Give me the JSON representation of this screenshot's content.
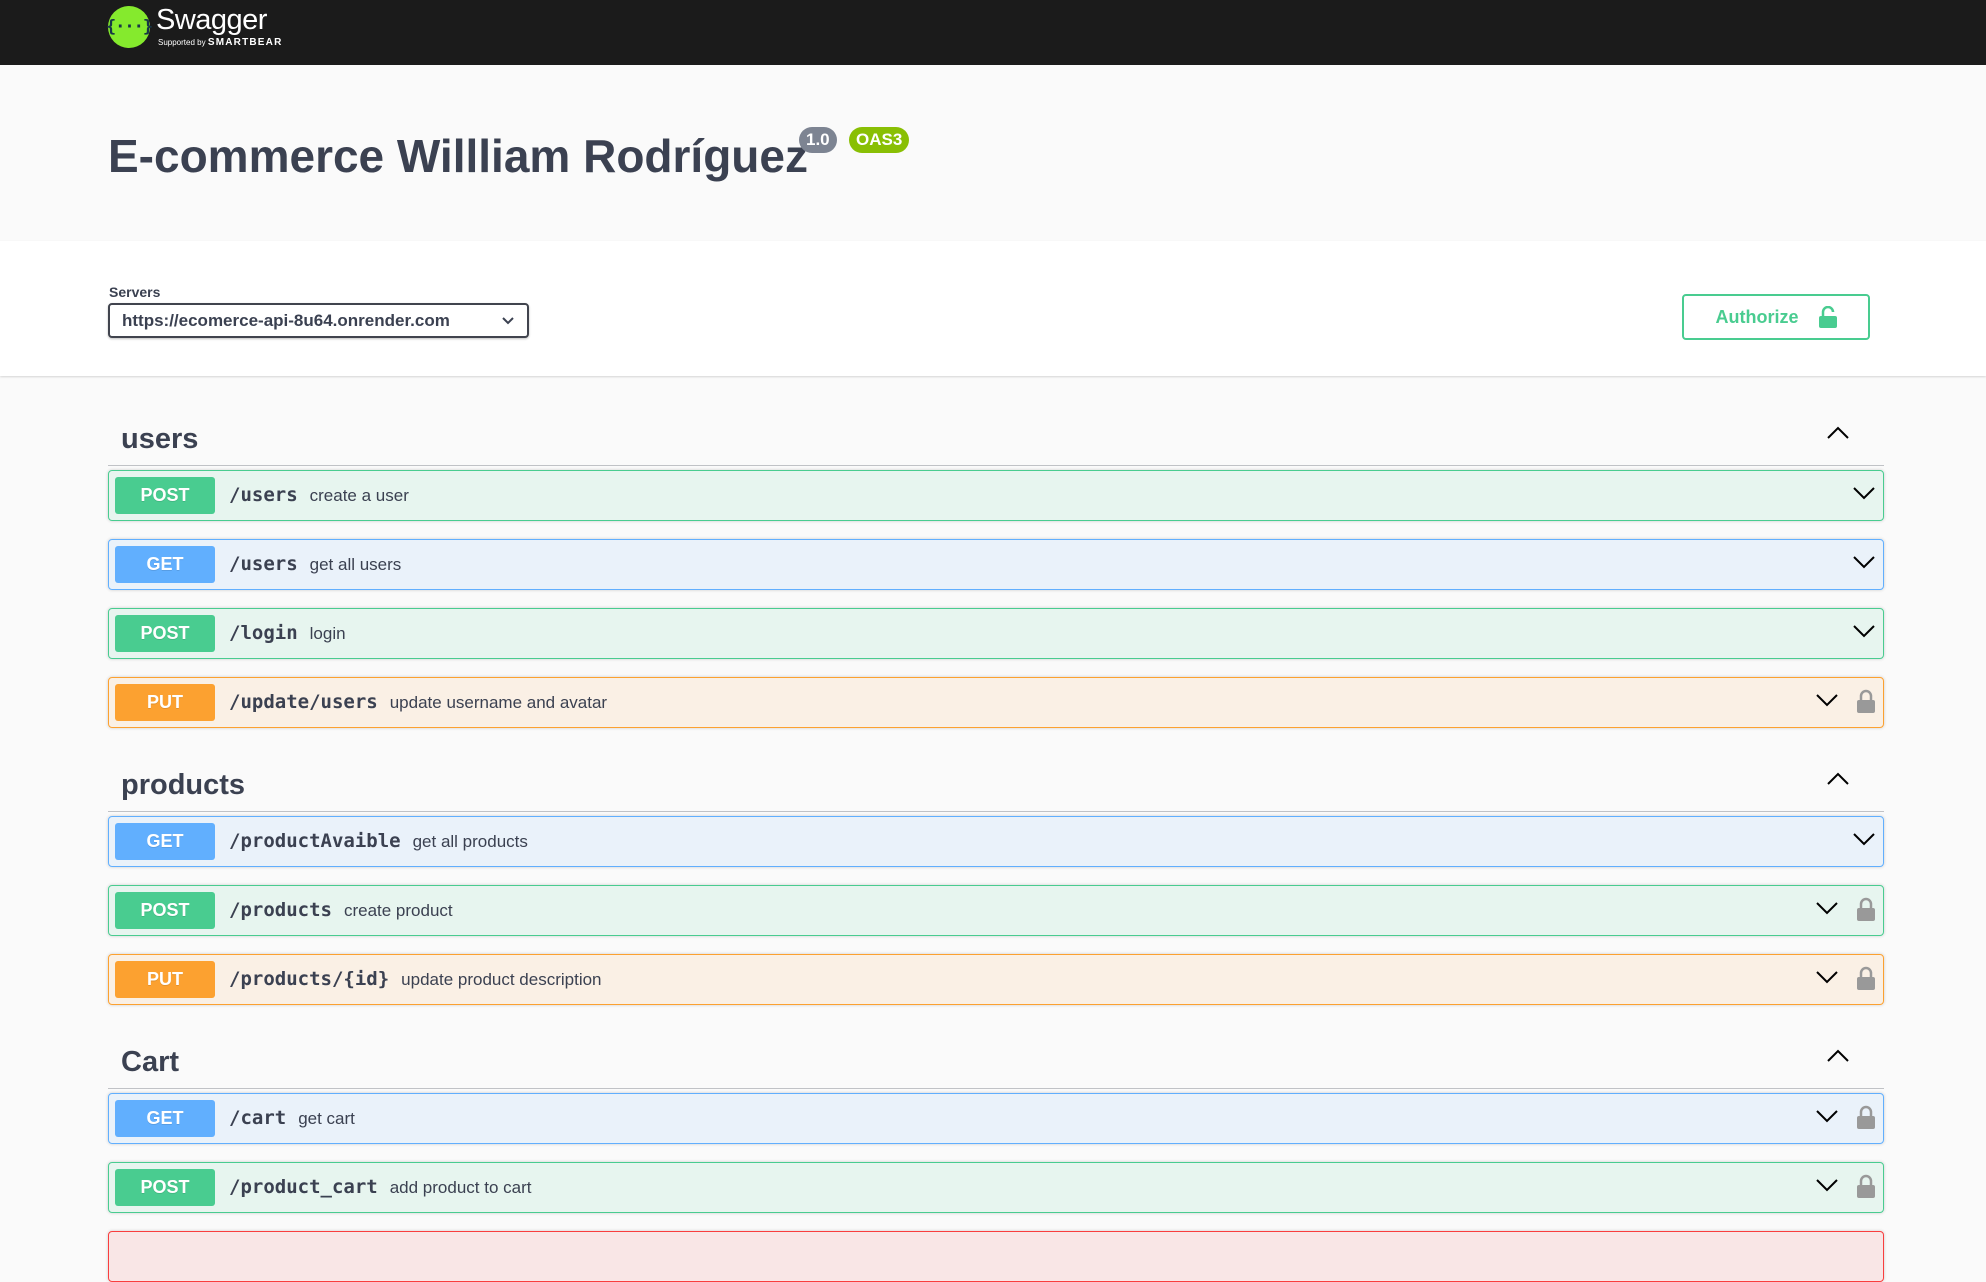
{
  "topbar": {
    "logo_symbol": "{···}",
    "logo_name": "Swagger",
    "logo_supported": "Supported by",
    "logo_brand": "SMARTBEAR"
  },
  "info": {
    "title": "E-commerce Willliam Rodríguez",
    "version": "1.0",
    "oas": "OAS3"
  },
  "servers": {
    "label": "Servers",
    "selected": "https://ecomerce-api-8u64.onrender.com"
  },
  "authorize": {
    "label": "Authorize",
    "icon": "lock-open-icon",
    "color": "#49cc90"
  },
  "colors": {
    "post": "#49cc90",
    "get": "#61affe",
    "put": "#fca130",
    "text": "#3b4151"
  },
  "tags": [
    {
      "name": "users",
      "operations": [
        {
          "method": "POST",
          "path": "/users",
          "summary": "create a user",
          "locked": false
        },
        {
          "method": "GET",
          "path": "/users",
          "summary": "get all users",
          "locked": false
        },
        {
          "method": "POST",
          "path": "/login",
          "summary": "login",
          "locked": false
        },
        {
          "method": "PUT",
          "path": "/update/users",
          "summary": "update username and avatar",
          "locked": true
        }
      ]
    },
    {
      "name": "products",
      "operations": [
        {
          "method": "GET",
          "path": "/productAvaible",
          "summary": "get all products",
          "locked": false
        },
        {
          "method": "POST",
          "path": "/products",
          "summary": "create product",
          "locked": true
        },
        {
          "method": "PUT",
          "path": "/products/{id}",
          "summary": "update product description",
          "locked": true
        }
      ]
    },
    {
      "name": "Cart",
      "operations": [
        {
          "method": "GET",
          "path": "/cart",
          "summary": "get cart",
          "locked": true
        },
        {
          "method": "POST",
          "path": "/product_cart",
          "summary": "add product to cart",
          "locked": true
        }
      ]
    }
  ]
}
